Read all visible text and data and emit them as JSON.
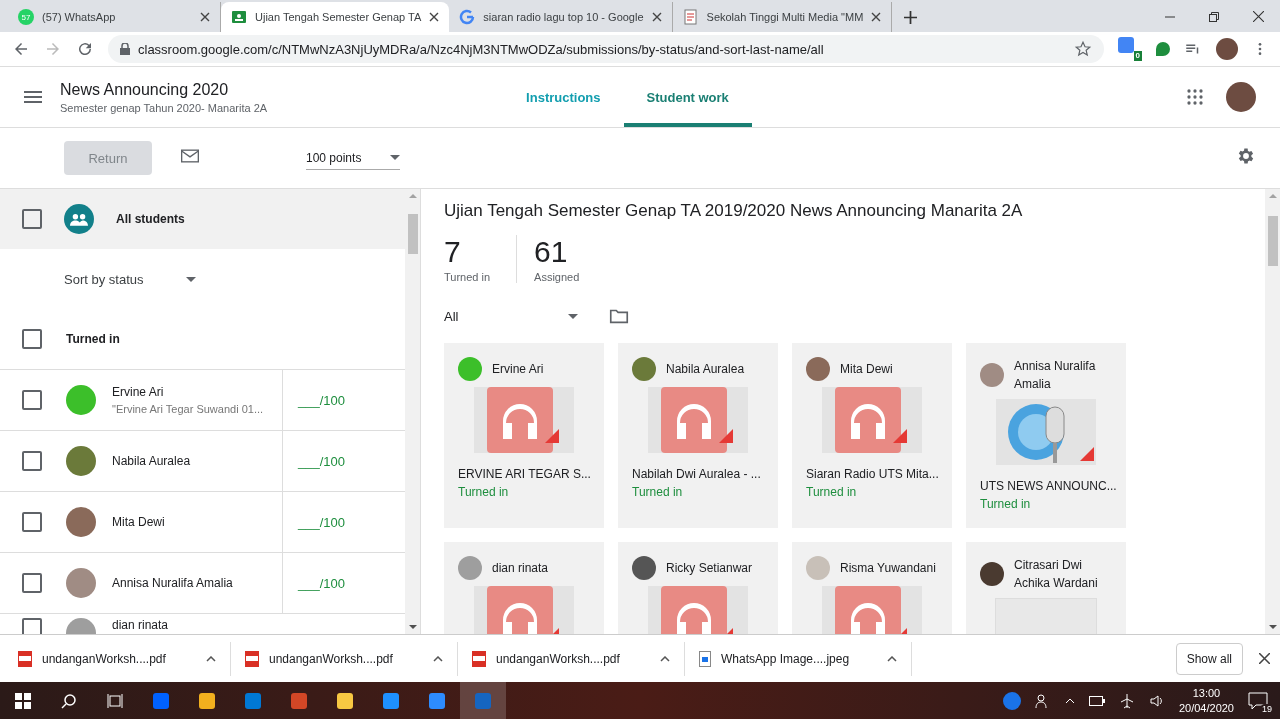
{
  "browser": {
    "tabs": [
      {
        "title": "(57) WhatsApp",
        "kind": "whatsapp",
        "badge": "57",
        "selected": false
      },
      {
        "title": "Ujian Tengah Semester Genap TA",
        "kind": "classroom",
        "selected": true
      },
      {
        "title": "siaran radio lagu top 10 - Google",
        "kind": "google",
        "selected": false
      },
      {
        "title": "Sekolah Tinggi Multi Media \"MM",
        "kind": "document",
        "selected": false
      }
    ],
    "url": "classroom.google.com/c/NTMwNzA3NjUyMDRa/a/Nzc4NjM3NTMwODZa/submissions/by-status/and-sort-last-name/all",
    "extension_badge": "0"
  },
  "header": {
    "title": "News Announcing 2020",
    "subtitle": "Semester genap Tahun 2020- Manarita 2A",
    "nav": [
      {
        "label": "Instructions",
        "selected": false
      },
      {
        "label": "Student work",
        "selected": true
      }
    ]
  },
  "toolbar": {
    "return_button": {
      "label": "Return",
      "disabled": true
    },
    "points": "100 points"
  },
  "sidebar": {
    "all_students": {
      "label": "All students",
      "checked": false
    },
    "sort": "Sort by status",
    "section": {
      "label": "Turned in",
      "checked": false
    },
    "students": [
      {
        "name": "Ervine Ari",
        "note": "\"Ervine Ari Tegar Suwandi 01...",
        "grade": "___/100",
        "checked": false,
        "color": "#3cbf2a"
      },
      {
        "name": "Nabila Auralea",
        "grade": "___/100",
        "checked": false,
        "color": "#6b7a3a"
      },
      {
        "name": "Mita Dewi",
        "grade": "___/100",
        "checked": false,
        "color": "#8a6a5a"
      },
      {
        "name": "Annisa Nuralifa Amalia",
        "grade": "___/100",
        "checked": false,
        "color": "#a08c84"
      },
      {
        "name": "dian rinata",
        "checked": false,
        "color": "#9e9e9e"
      }
    ]
  },
  "assignment": {
    "title": "Ujian Tengah Semester Genap TA 2019/2020 News Announcing Manarita 2A",
    "stats": [
      {
        "value": "7",
        "label": "Turned in"
      },
      {
        "value": "61",
        "label": "Assigned"
      }
    ],
    "filter": "All",
    "cards": [
      {
        "name": "Ervine Ari",
        "file": "ERVINE ARI TEGAR S...",
        "status": "Turned in",
        "kind": "audio",
        "color": "#3cbf2a"
      },
      {
        "name": "Nabila Auralea",
        "file": "Nabilah Dwi Auralea - ...",
        "status": "Turned in",
        "kind": "audio",
        "color": "#6b7a3a"
      },
      {
        "name": "Mita Dewi",
        "file": "Siaran Radio UTS Mita...",
        "status": "Turned in",
        "kind": "audio",
        "color": "#8a6a5a"
      },
      {
        "name": "Annisa Nuralifa Amalia",
        "file": "UTS NEWS ANNOUNC...",
        "status": "Turned in",
        "kind": "microphone",
        "color": "#a08c84"
      },
      {
        "name": "dian rinata",
        "kind": "audio",
        "color": "#9e9e9e"
      },
      {
        "name": "Ricky Setianwar",
        "kind": "audio",
        "color": "#555555"
      },
      {
        "name": "Risma Yuwandani",
        "kind": "audio",
        "color": "#c8c0b8"
      },
      {
        "name": "Citrasari Dwi Achika Wardani",
        "kind": "blank",
        "color": "#4a3a30"
      }
    ]
  },
  "downloads": {
    "items": [
      {
        "name": "undanganWorksh....pdf",
        "kind": "pdf"
      },
      {
        "name": "undanganWorksh....pdf",
        "kind": "pdf"
      },
      {
        "name": "undanganWorksh....pdf",
        "kind": "pdf"
      },
      {
        "name": "WhatsApp Image....jpeg",
        "kind": "image"
      }
    ],
    "show_all": "Show all"
  },
  "taskbar": {
    "time": "13:00",
    "date": "20/04/2020",
    "notifications": "19"
  }
}
